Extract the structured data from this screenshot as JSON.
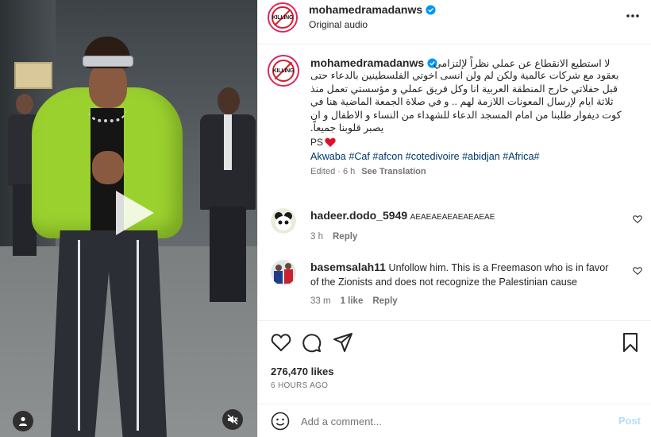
{
  "header": {
    "username": "mohamedramadanws",
    "subtitle": "Original audio",
    "avatar_text": "KILLING"
  },
  "caption": {
    "username": "mohamedramadanws",
    "first_line": "لا استطيع الانقطاع عن عملي نظراً لإلتزامي",
    "text": "بعقود مع شركات عالمية ولكن لم ولن انسى اخوتي الفلسطينين بالدعاء حتى قبل حفلاتي خارج المنطقة العربية انا وكل فريق عملي و مؤسستي تعمل منذ ثلاثة ايام لإرسال المعونات اللازمة لهم .. و في صلاة الجمعة الماضية هنا في كوت ديفوار طلبنا من امام المسجد الدعاء للشهداء من النساء و الاطفال و ان يصبر قلوبنا جميعاً.",
    "ps": "PS",
    "hashtags": [
      "Akwaba",
      "#Caf",
      "#afcon",
      "#cotedivoire",
      "#abidjan",
      "#Africa#"
    ],
    "edited": "Edited · 6 h",
    "see_translation": "See Translation"
  },
  "comments": [
    {
      "username": "hadeer.dodo_5949",
      "text": "AEAEAEAEAEAEAEAE",
      "time": "3 h",
      "reply": "Reply"
    },
    {
      "username": "basemsalah11",
      "text": "Unfollow him. This is a Freemason who is in favor of the Zionists and does not recognize the Palestinian cause",
      "time": "33 m",
      "likes": "1 like",
      "reply": "Reply"
    }
  ],
  "actions": {
    "likes": "276,470 likes",
    "time_ago": "6 HOURS AGO"
  },
  "comment_box": {
    "placeholder": "Add a comment...",
    "post": "Post"
  },
  "colors": {
    "accent": "#0095f6",
    "post_disabled": "#b2dffc",
    "verified": "#0095f6",
    "heart": "#ed4956",
    "hashtag": "#00376b"
  }
}
